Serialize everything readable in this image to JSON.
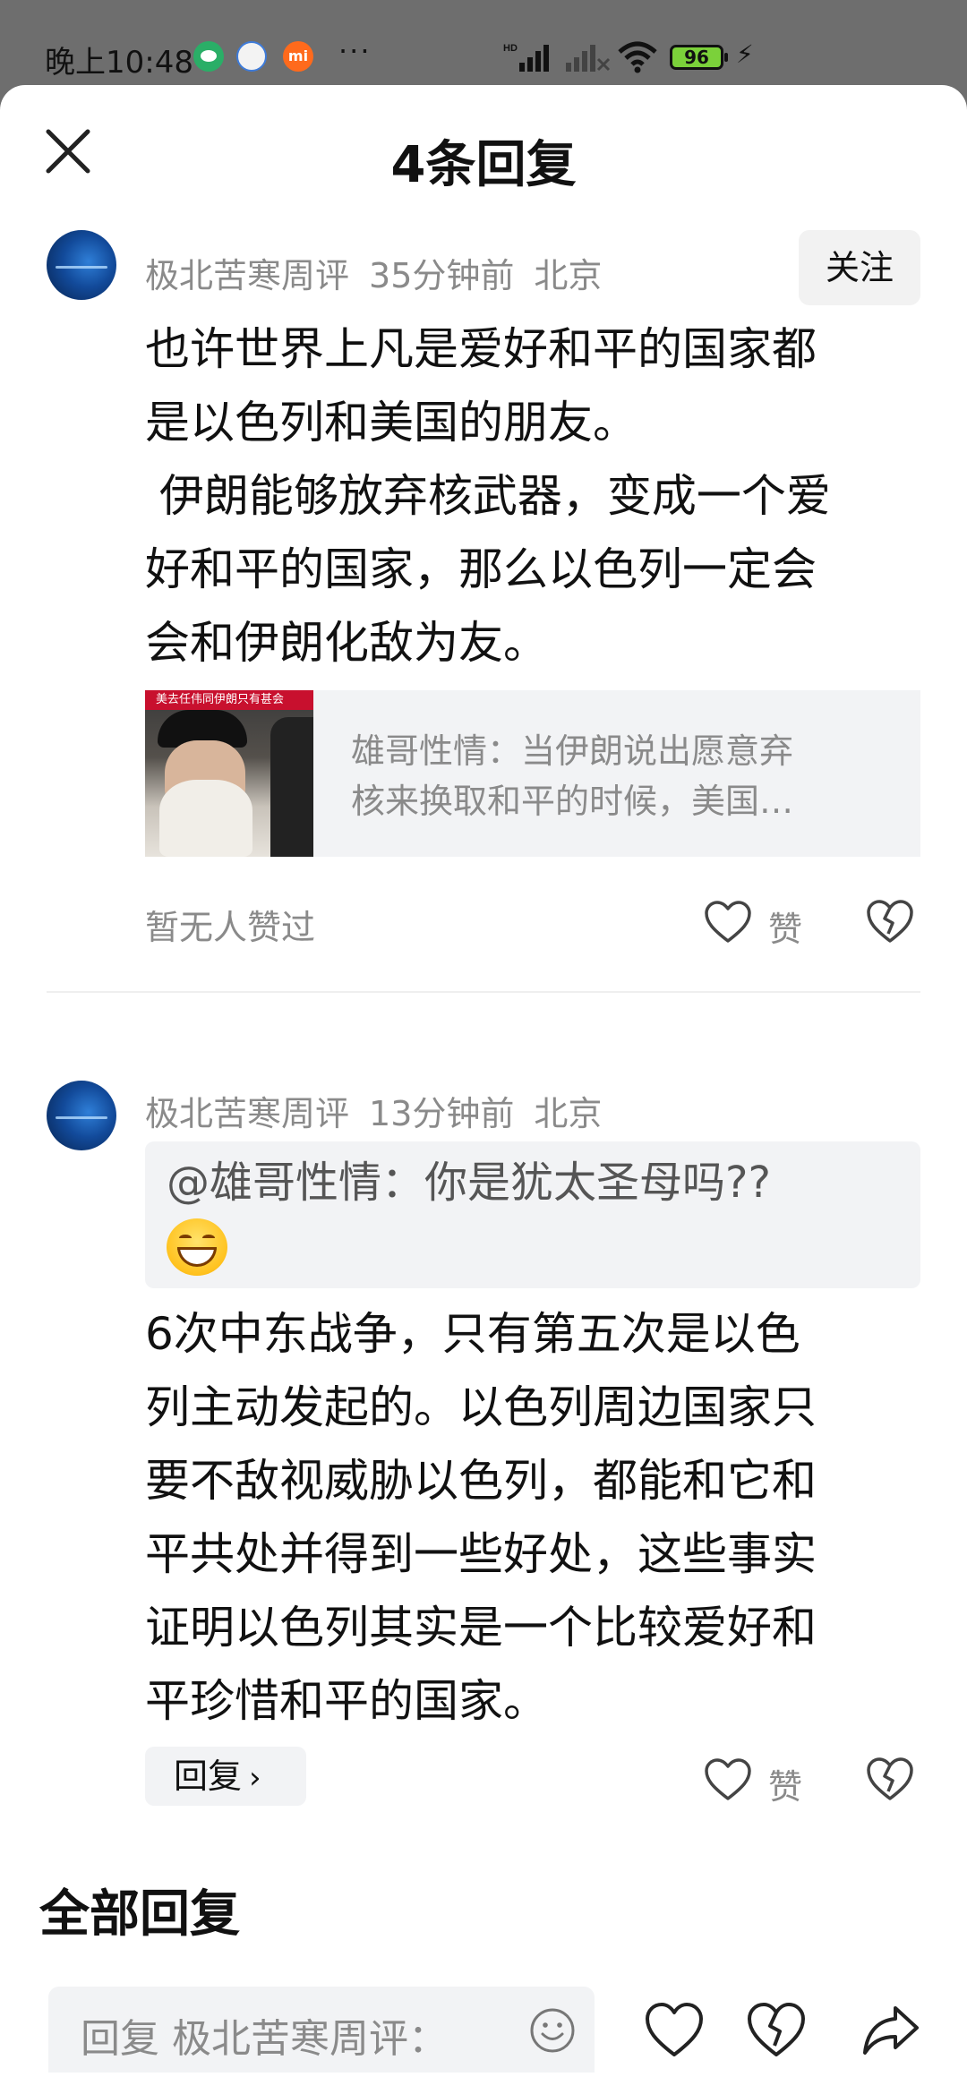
{
  "status_bar": {
    "time": "晚上10:48",
    "dots": "···",
    "battery": "96",
    "icons": [
      "wechat-icon",
      "baidu-icon",
      "mi-icon",
      "hd-signal-icon",
      "signal-icon",
      "wifi-icon",
      "battery-icon",
      "charging-icon"
    ]
  },
  "sheet": {
    "title": "4条回复",
    "close_icon": "close-icon"
  },
  "comment1": {
    "author": "极北苦寒周评",
    "time": "35分钟前",
    "location": "北京",
    "follow_label": "关注",
    "text": "也许世界上凡是爱好和平的国家都\n是以色列和美国的朋友。\n 伊朗能够放弃核武器，变成一个爱\n好和平的国家，那么以色列一定会\n会和伊朗化敌为友。",
    "link_card": {
      "thumb_banner": "美去任伟同伊朗只有甚会",
      "line1": "雄哥性情：当伊朗说出愿意弃",
      "line2": "核来换取和平的时候，美国…"
    },
    "no_likes": "暂无人赞过",
    "like_label": "赞"
  },
  "comment2": {
    "author": "极北苦寒周评",
    "time": "13分钟前",
    "location": "北京",
    "quote": "@雄哥性情：你是犹太圣母吗??",
    "text": "6次中东战争，只有第五次是以色\n列主动发起的。以色列周边国家只\n要不敌视威胁以色列，都能和它和\n平共处并得到一些好处，这些事实\n证明以色列其实是一个比较爱好和\n平珍惜和平的国家。",
    "reply_label": "回复",
    "like_label": "赞"
  },
  "all_replies_heading": "全部回复",
  "input": {
    "placeholder": "回复 极北苦寒周评："
  },
  "colors": {
    "meta_gray": "#8a8a8a",
    "card_bg": "#f2f3f5",
    "text": "#111111"
  }
}
